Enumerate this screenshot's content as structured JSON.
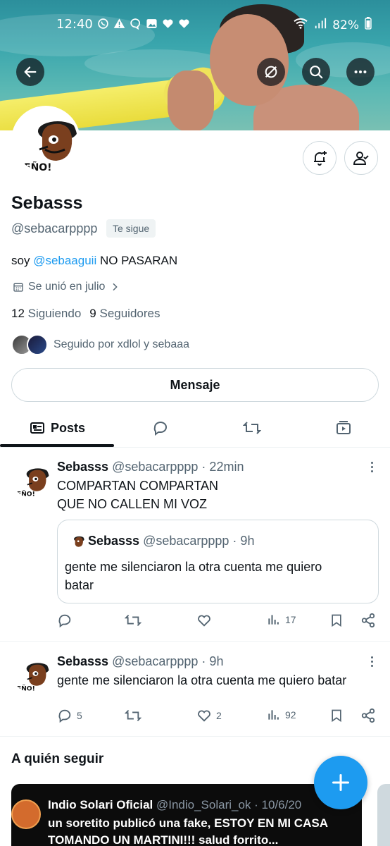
{
  "status_bar": {
    "time": "12:40",
    "battery": "82%"
  },
  "profile": {
    "avatar_text": "EÑO!",
    "name": "Sebasss",
    "handle": "@sebacarpppp",
    "follows_you_badge": "Te sigue",
    "bio_prefix": "soy ",
    "bio_mention": "@sebaaguii",
    "bio_suffix": " NO PASARAN",
    "joined": "Se unió en julio",
    "following_count": "12",
    "following_label": "Siguiendo",
    "followers_count": "9",
    "followers_label": "Seguidores",
    "followed_by": "Seguido por xdlol y sebaaa",
    "message_button": "Mensaje"
  },
  "tabs": {
    "posts_label": "Posts"
  },
  "posts": [
    {
      "name": "Sebasss",
      "meta": "@sebacarpppp · 22min",
      "line1": "COMPARTAN COMPARTAN",
      "line2": "QUE NO CALLEN MI VOZ",
      "quote": {
        "name": "Sebasss",
        "meta": "@sebacarpppp · 9h",
        "line1": "gente me silenciaron la otra cuenta me quiero",
        "line2": "batar"
      },
      "views": "17"
    },
    {
      "name": "Sebasss",
      "meta": "@sebacarpppp · 9h",
      "text": "gente me silenciaron la otra cuenta me quiero batar",
      "replies": "5",
      "likes": "2",
      "views": "92"
    }
  ],
  "who_to_follow": {
    "title": "A quién seguir",
    "card": {
      "name": "Indio Solari Oficial",
      "meta": "@Indio_Solari_ok · 10/6/20",
      "line1": "un soretito publicó una fake, ESTOY EN MI CASA",
      "line2": "TOMANDO UN MARTINI!!! salud forrito..."
    }
  },
  "colors": {
    "accent": "#1d9bf0",
    "text": "#0f1419",
    "muted": "#536471",
    "border": "#cfd9de"
  },
  "icons": [
    "back-arrow-icon",
    "grok-icon",
    "search-icon",
    "more-icon",
    "bell-plus-icon",
    "following-check-icon",
    "calendar-icon",
    "chevron-right-icon",
    "tweets-icon",
    "reply-icon",
    "repost-icon",
    "media-icon",
    "like-icon",
    "views-icon",
    "bookmark-icon",
    "share-icon",
    "compose-plus-icon"
  ]
}
